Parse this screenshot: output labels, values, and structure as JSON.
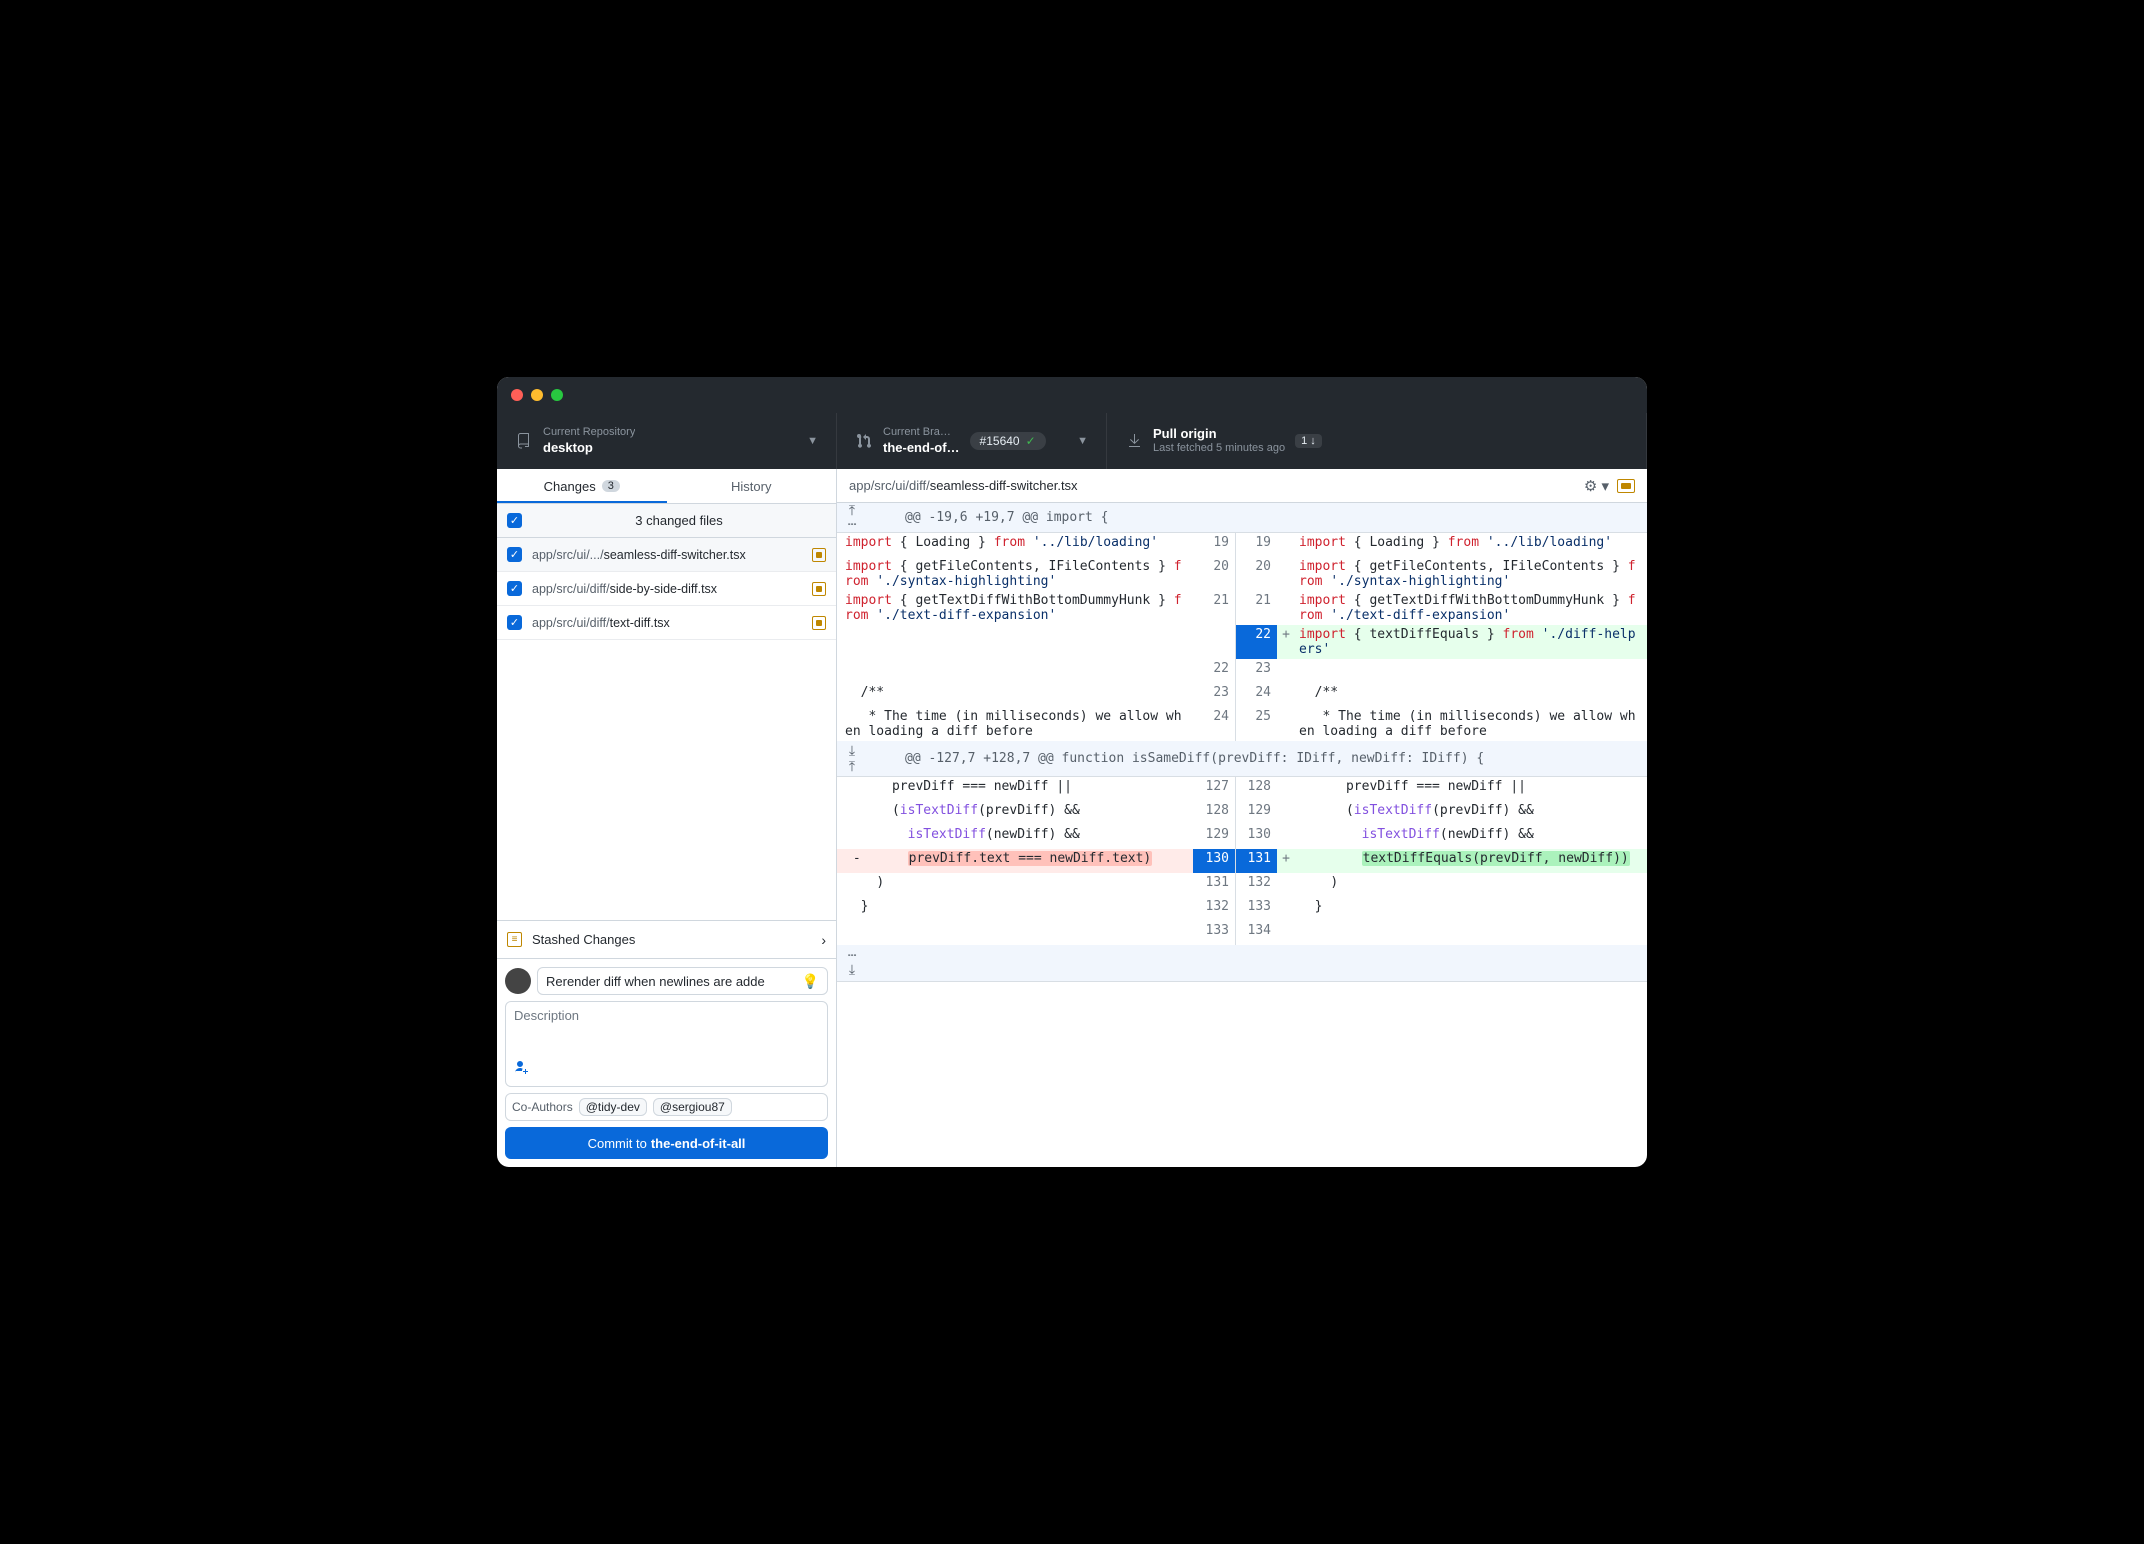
{
  "toolbar": {
    "repo_label": "Current Repository",
    "repo_name": "desktop",
    "branch_label": "Current Bra…",
    "branch_name": "the-end-of…",
    "pr_number": "#15640",
    "pull_title": "Pull origin",
    "pull_subtitle": "Last fetched 5 minutes ago",
    "pull_badge": "1 ↓"
  },
  "tabs": {
    "changes": "Changes",
    "changes_count": "3",
    "history": "History"
  },
  "files": {
    "header": "3 changed files",
    "items": [
      {
        "dir": "app/src/ui/.../",
        "name": "seamless-diff-switcher.tsx"
      },
      {
        "dir": "app/src/ui/diff/",
        "name": "side-by-side-diff.tsx"
      },
      {
        "dir": "app/src/ui/diff/",
        "name": "text-diff.tsx"
      }
    ]
  },
  "stash_label": "Stashed Changes",
  "commit": {
    "summary": "Rerender diff when newlines are adde",
    "description_placeholder": "Description",
    "coauthor_label": "Co-Authors",
    "coauthors": [
      "@tidy-dev",
      "@sergiou87"
    ],
    "button_prefix": "Commit to ",
    "button_branch": "the-end-of-it-all"
  },
  "diff": {
    "filepath_dir": "app/src/ui/diff/",
    "filepath_name": "seamless-diff-switcher.tsx",
    "hunk1": "@@ -19,6 +19,7 @@ import {",
    "hunk2": "@@ -127,7 +128,7 @@ function isSameDiff(prevDiff: IDiff, newDiff: IDiff) {",
    "rows1": [
      {
        "ln": "19",
        "rn": "19",
        "sign": "",
        "type": "context",
        "left": "  import { Loading } from '../lib/loading'",
        "right": "  import { Loading } from '../lib/loading'"
      },
      {
        "ln": "20",
        "rn": "20",
        "sign": "",
        "type": "context",
        "left": "  import { getFileContents, IFileContents } from './syntax-highlighting'",
        "right": "  import { getFileContents, IFileContents } from './syntax-highlighting'"
      },
      {
        "ln": "21",
        "rn": "21",
        "sign": "",
        "type": "context",
        "left": "  import { getTextDiffWithBottomDummyHunk } from './text-diff-expansion'",
        "right": "  import { getTextDiffWithBottomDummyHunk } from './text-diff-expansion'"
      },
      {
        "ln": "",
        "rn": "22",
        "sign": "+",
        "type": "add",
        "left": "",
        "right": "  import { textDiffEquals } from './diff-helpers'"
      },
      {
        "ln": "22",
        "rn": "23",
        "sign": "",
        "type": "context",
        "left": "",
        "right": ""
      },
      {
        "ln": "23",
        "rn": "24",
        "sign": "",
        "type": "context",
        "left": "  /**",
        "right": "  /**"
      },
      {
        "ln": "24",
        "rn": "25",
        "sign": "",
        "type": "context",
        "left": "   * The time (in milliseconds) we allow when loading a diff before",
        "right": "   * The time (in milliseconds) we allow when loading a diff before"
      }
    ],
    "rows2": [
      {
        "ln": "127",
        "rn": "128",
        "sign": "",
        "type": "context",
        "left": "      prevDiff === newDiff ||",
        "right": "      prevDiff === newDiff ||"
      },
      {
        "ln": "128",
        "rn": "129",
        "sign": "",
        "type": "context",
        "left": "      (isTextDiff(prevDiff) &&",
        "right": "      (isTextDiff(prevDiff) &&"
      },
      {
        "ln": "129",
        "rn": "130",
        "sign": "",
        "type": "context",
        "left": "        isTextDiff(newDiff) &&",
        "right": "        isTextDiff(newDiff) &&"
      },
      {
        "ln": "130",
        "rn": "131",
        "sign": "±",
        "type": "change",
        "left": "        prevDiff.text === newDiff.text)",
        "right": "        textDiffEquals(prevDiff, newDiff))"
      },
      {
        "ln": "131",
        "rn": "132",
        "sign": "",
        "type": "context",
        "left": "    )",
        "right": "    )"
      },
      {
        "ln": "132",
        "rn": "133",
        "sign": "",
        "type": "context",
        "left": "  }",
        "right": "  }"
      },
      {
        "ln": "133",
        "rn": "134",
        "sign": "",
        "type": "context",
        "left": "",
        "right": ""
      }
    ]
  }
}
